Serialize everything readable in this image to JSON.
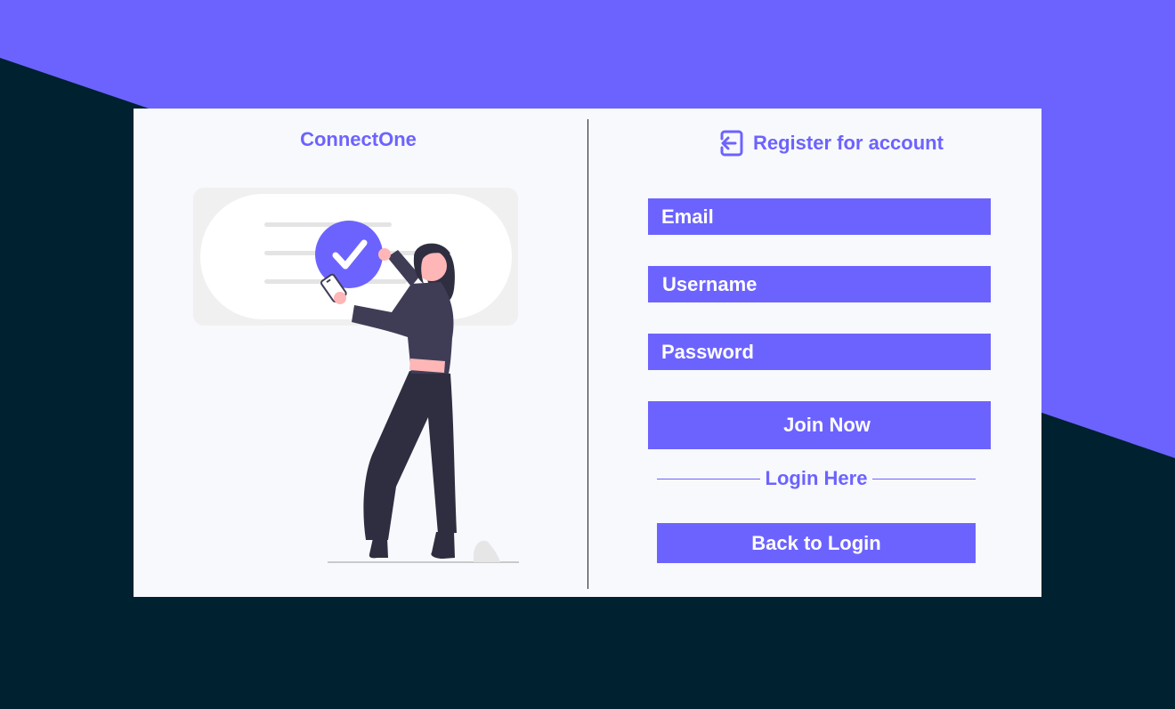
{
  "colors": {
    "accent": "#6c63ff",
    "dark_bg": "#00212f",
    "card_bg": "#f8f9fd",
    "figure_dark": "#2f2e41",
    "figure_skin": "#ffb6b6"
  },
  "left_panel": {
    "brand": "ConnectOne",
    "illustration": "woman-holding-phone-with-checkmark"
  },
  "right_panel": {
    "title": "Register for account",
    "title_icon": "login-arrow-icon",
    "email_label": "Email",
    "username_label": "Username",
    "password_label": "Password",
    "join_button": "Join Now",
    "separator_text": "Login Here",
    "back_button": "Back to Login"
  }
}
